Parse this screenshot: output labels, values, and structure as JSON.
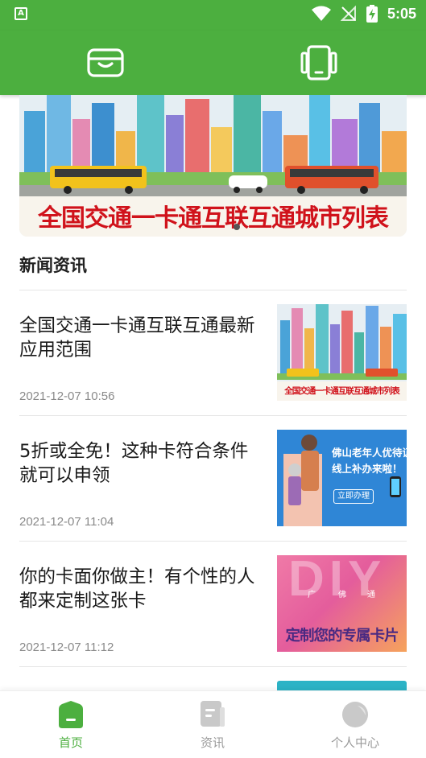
{
  "status_bar": {
    "left_badge": "A",
    "time": "5:05"
  },
  "top_bar": {
    "left_icon": "card-wallet-icon",
    "right_icon": "phone-device-icon"
  },
  "banner": {
    "caption": "全国交通一卡通互联互通城市列表"
  },
  "section": {
    "title": "新闻资讯"
  },
  "news": [
    {
      "title": "全国交通一卡通互联互通最新应用范围",
      "time": "2021-12-07 10:56",
      "thumb_caption": "全国交通一卡通互联互通城市列表"
    },
    {
      "title": "5折或全免！这种卡符合条件就可以申领",
      "time": "2021-12-07 11:04",
      "thumb_text": [
        "佛山老年人优待证",
        "线上补办来啦！"
      ],
      "thumb_button": "立即办理"
    },
    {
      "title": "你的卡面你做主！有个性的人都来定制这张卡",
      "time": "2021-12-07 11:12",
      "thumb_big": "DIY",
      "thumb_small": [
        "广",
        "佛",
        "通"
      ],
      "thumb_caption": "定制您的专属卡片"
    }
  ],
  "tabs": [
    {
      "label": "首页",
      "icon": "home-icon",
      "active": true
    },
    {
      "label": "资讯",
      "icon": "news-icon",
      "active": false
    },
    {
      "label": "个人中心",
      "icon": "profile-icon",
      "active": false
    }
  ],
  "colors": {
    "brand": "#4caf3f",
    "tab_inactive": "#9a9a9a",
    "caption_red": "#d0121b"
  }
}
